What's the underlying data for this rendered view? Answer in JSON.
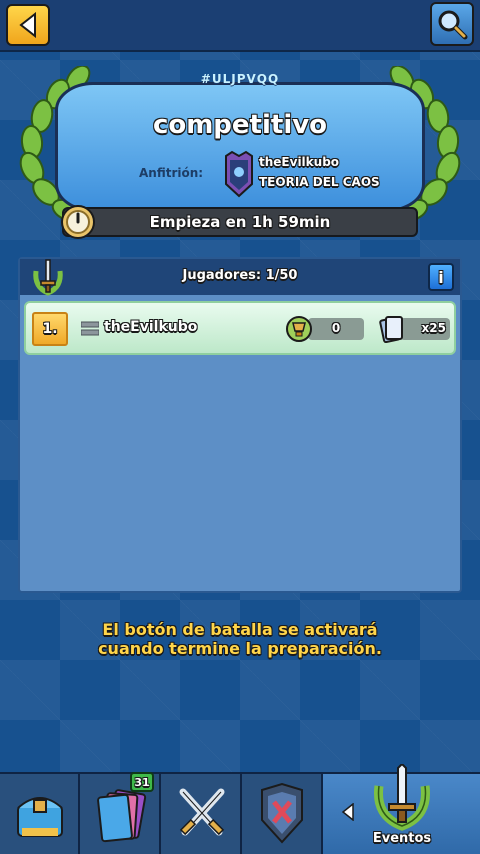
{
  "header": {
    "back_icon": "back-arrow-icon",
    "search_icon": "search-icon"
  },
  "tournament": {
    "tag": "#ULJPVQQ",
    "name": "competitivo",
    "host_label": "Anfitrión:",
    "host_name": "theEvilkubo",
    "host_clan": "TEORIA DEL CAOS",
    "countdown": "Empieza en 1h 59min"
  },
  "players_panel": {
    "title": "Jugadores: 1/50",
    "info_label": "i",
    "players": [
      {
        "rank": "1.",
        "name": "theEvilkubo",
        "trophies": "0",
        "cards": "x25"
      }
    ]
  },
  "notice": "El botón de batalla se activará cuando termine la preparación.",
  "nav": {
    "cards_badge": "31",
    "events_label": "Eventos",
    "active": "Eventos"
  },
  "colors": {
    "background": "#17518f",
    "banner": "#5ba9eb",
    "accent_gold": "#ffd54a",
    "player_row": "#d3f3dc",
    "nav_active": "#3f7cbd"
  }
}
